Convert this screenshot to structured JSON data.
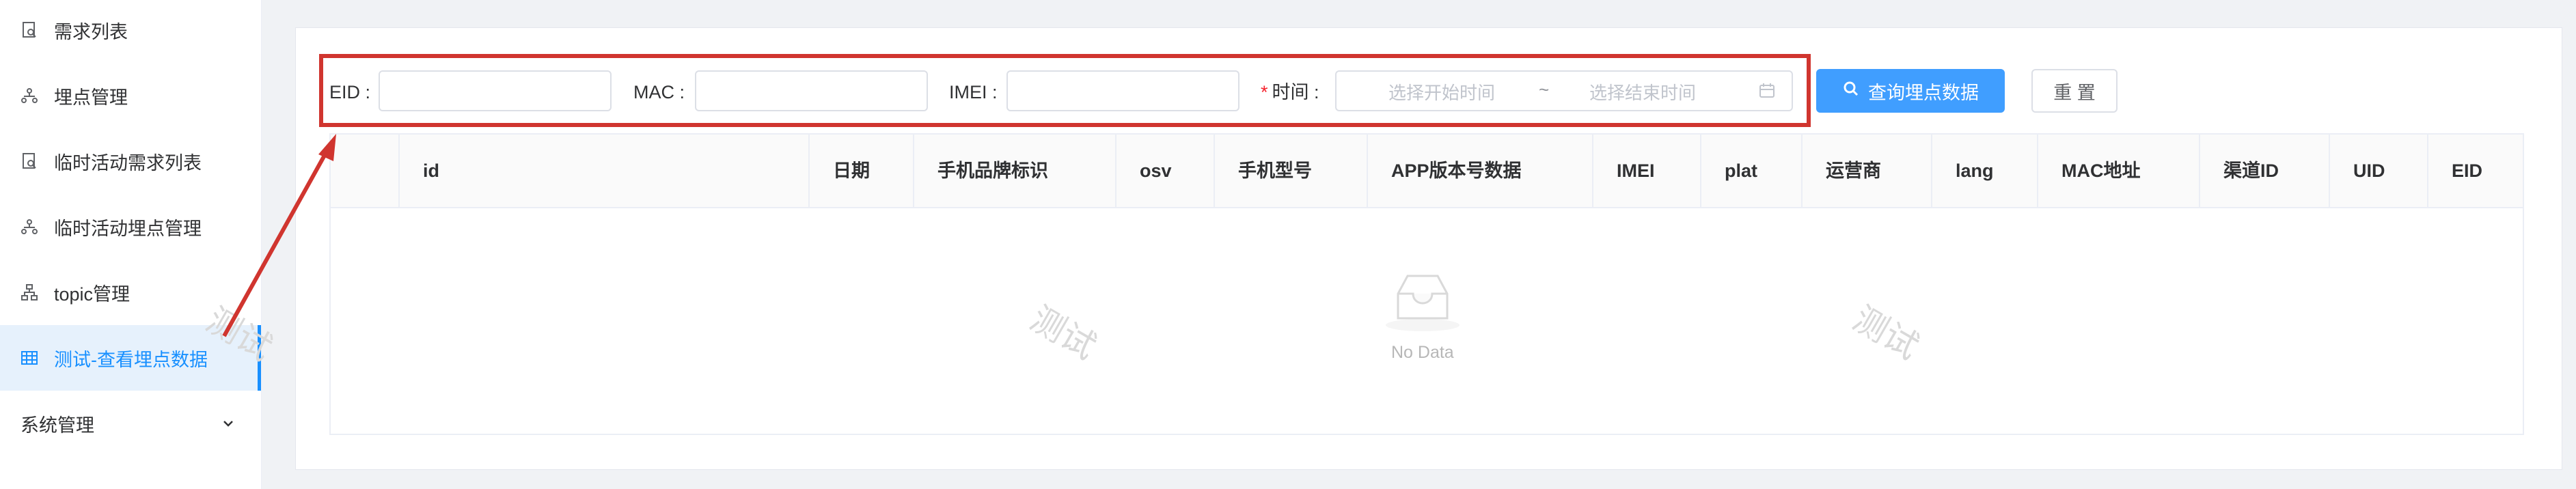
{
  "sidebar": {
    "items": [
      {
        "label": "需求列表",
        "icon": "doc-search-icon"
      },
      {
        "label": "埋点管理",
        "icon": "network-icon"
      },
      {
        "label": "临时活动需求列表",
        "icon": "doc-search-icon"
      },
      {
        "label": "临时活动埋点管理",
        "icon": "network-icon"
      },
      {
        "label": "topic管理",
        "icon": "tree-icon"
      },
      {
        "label": "测试-查看埋点数据",
        "icon": "table-icon",
        "active": true
      },
      {
        "label": "系统管理",
        "icon": "chevron-down-icon"
      }
    ]
  },
  "filters": {
    "eid_label": "EID :",
    "mac_label": "MAC :",
    "imei_label": "IMEI :",
    "time_required": "*",
    "time_label": "时间 :",
    "start_placeholder": "选择开始时间",
    "range_separator": "~",
    "end_placeholder": "选择结束时间"
  },
  "buttons": {
    "query": "查询埋点数据",
    "reset": "重 置"
  },
  "table": {
    "columns": [
      "",
      "id",
      "日期",
      "手机品牌标识",
      "osv",
      "手机型号",
      "APP版本号数据",
      "IMEI",
      "plat",
      "运营商",
      "lang",
      "MAC地址",
      "渠道ID",
      "UID",
      "EID"
    ],
    "empty_text": "No Data"
  },
  "watermark": "测试",
  "colors": {
    "primary": "#409eff",
    "active_bg": "#e6f1fc",
    "highlight": "#d0352f"
  }
}
